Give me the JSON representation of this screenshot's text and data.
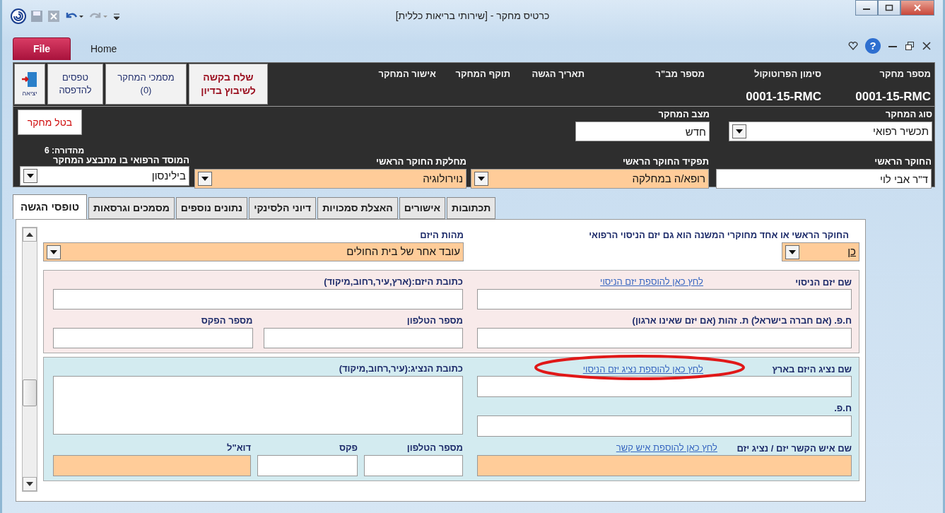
{
  "window": {
    "title": "כרטיס מחקר - [שירותי בריאות כללית]"
  },
  "ribbon": {
    "file_tab": "File",
    "home_tab": "Home",
    "help_glyph": "?"
  },
  "header": {
    "fields": [
      {
        "label": "מספר מחקר",
        "value": "0001-15-RMC"
      },
      {
        "label": "סימון הפרוטוקול",
        "value": "0001-15-RMC"
      },
      {
        "label": "מספר מב\"ר"
      },
      {
        "label": "תאריך הגשה"
      },
      {
        "label": "תוקף המחקר"
      },
      {
        "label": "אישור המחקר"
      }
    ],
    "buttons": [
      {
        "kind": "send",
        "lines": [
          "שלח בקשה",
          "לשיבוץ בדיון"
        ]
      },
      {
        "kind": "docs",
        "lines": [
          "מסמכי המחקר",
          "(0)"
        ]
      },
      {
        "kind": "print",
        "lines": [
          "טפסים",
          "להדפסה"
        ]
      },
      {
        "kind": "exit",
        "lines": [
          "יציאה"
        ]
      }
    ]
  },
  "study": {
    "type": {
      "label": "סוג המחקר",
      "value": "תכשיר רפואי",
      "kind": "dropdown",
      "required": false
    },
    "status": {
      "label": "מצב המחקר",
      "value": "חדש",
      "kind": "text",
      "required": false
    },
    "cancel_button": "בטל מחקר",
    "investigator": {
      "label": "החוקר הראשי",
      "value": "ד\"ר אבי לוי",
      "kind": "text",
      "required": false
    },
    "role": {
      "label": "תפקיד החוקר הראשי",
      "value": "רופא/ה במחלקה",
      "kind": "dropdown",
      "required": true
    },
    "department": {
      "label": "מחלקת החוקר הראשי",
      "value": "נוירולוגיה",
      "kind": "dropdown",
      "required": true
    },
    "edition": "מהדורה: 6",
    "institution": {
      "label": "המוסד הרפואי בו מתבצע המחקר",
      "value": "בילינסון",
      "kind": "dropdown",
      "required": false
    }
  },
  "tabs": [
    {
      "label": "תכתובות",
      "selected": false
    },
    {
      "label": "אישורים",
      "selected": false
    },
    {
      "label": "האצלת סמכויות",
      "selected": false
    },
    {
      "label": "דיוני הלסינקי",
      "selected": false
    },
    {
      "label": "נתונים נוספים",
      "selected": false
    },
    {
      "label": "מסמכים וגרסאות",
      "selected": false
    },
    {
      "label": "טופסי הגשה",
      "selected": true
    }
  ],
  "form": {
    "sponsor_question": {
      "label": "החוקר הראשי או אחד מחוקרי המשנה הוא גם יזם הניסוי הרפואי",
      "value": "כן",
      "kind": "dropdown",
      "required": true
    },
    "sponsor_nature": {
      "label": "מהות היזם",
      "value": "עובד אחר של בית החולים",
      "kind": "dropdown",
      "required": true
    },
    "sponsor_section": {
      "name": {
        "label": "שם יזם הניסוי",
        "link": "לחץ כאן להוספת יזם הניסוי",
        "circled": false,
        "kind": "text",
        "required": false
      },
      "address": {
        "label": "כתובת היזם:(ארץ,עיר,רחוב,מיקוד)",
        "kind": "text",
        "required": false
      },
      "id": {
        "label": "ח.פ. (אם חברה בישראל) ת. זהות (אם יזם שאינו ארגון)",
        "kind": "text",
        "required": false
      },
      "phone": {
        "label": "מספר הטלפון",
        "kind": "text",
        "required": false
      },
      "fax": {
        "label": "מספר הפקס",
        "kind": "text",
        "required": false
      }
    },
    "representative_section": {
      "name": {
        "label": "שם נציג היזם בארץ",
        "link": "לחץ כאן להוספת נציג יזם הניסוי",
        "circled": true,
        "kind": "text",
        "required": false
      },
      "address": {
        "label": "כתובת הנציג:(עיר,רחוב,מיקוד)",
        "kind": "textarea",
        "required": false
      },
      "id": {
        "label": "ח.פ.",
        "kind": "text",
        "required": false
      },
      "contact": {
        "label": "שם איש הקשר יזם / נציג יזם",
        "link": "לחץ כאן להוספת איש קשר",
        "circled": false,
        "kind": "text",
        "required": true
      },
      "phone": {
        "label": "מספר הטלפון",
        "kind": "text",
        "required": false
      },
      "fax": {
        "label": "פקס",
        "kind": "text",
        "required": false
      },
      "email": {
        "label": "דוא\"ל",
        "kind": "text",
        "required": true
      }
    }
  }
}
